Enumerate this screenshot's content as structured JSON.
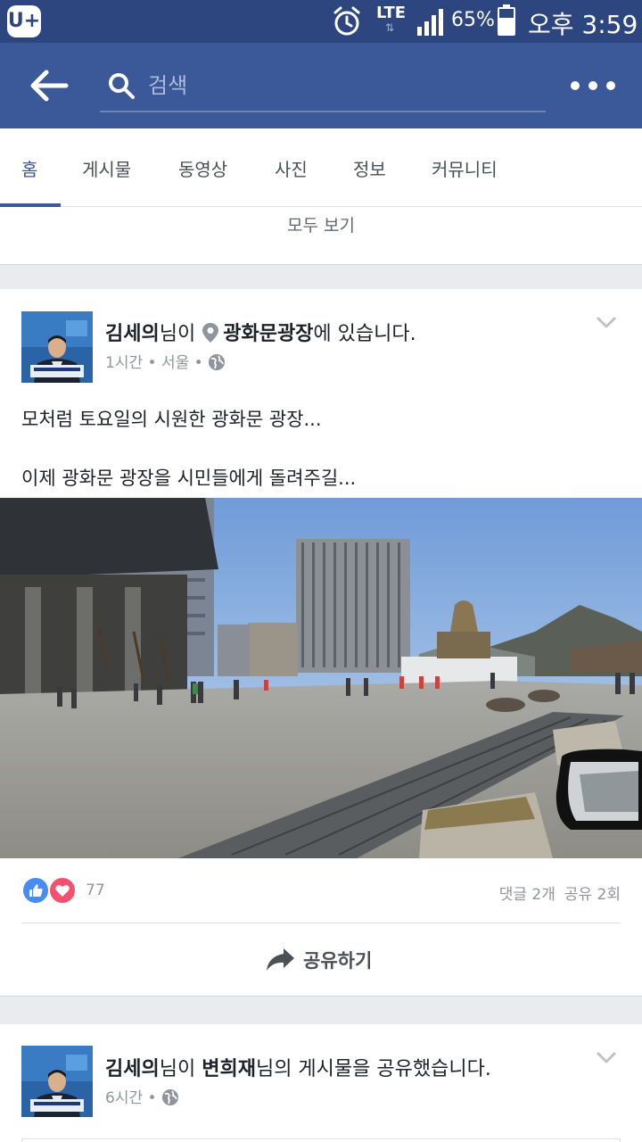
{
  "status_bar": {
    "carrier_logo": "U+",
    "network": "LTE",
    "battery_percent": "65%",
    "battery_level": 0.65,
    "time": "오후 3:59"
  },
  "nav": {
    "search_placeholder": "검색",
    "back_icon": "arrow-left-icon",
    "more_icon": "more-dots-icon"
  },
  "tabs": [
    {
      "label": "홈",
      "active": true
    },
    {
      "label": "게시물",
      "active": false
    },
    {
      "label": "동영상",
      "active": false
    },
    {
      "label": "사진",
      "active": false
    },
    {
      "label": "정보",
      "active": false
    },
    {
      "label": "커뮤니티",
      "active": false
    }
  ],
  "see_all": "모두 보기",
  "posts": [
    {
      "author": "김세의",
      "header_mid": "님이 ",
      "place": "광화문광장",
      "header_tail": "에 있습니다.",
      "time": "1시간",
      "location": "서울",
      "text_lines": [
        "모처럼 토요일의 시원한 광화문 광장...",
        "이제 광화문 광장을 시민들에게 돌려주길..."
      ],
      "reaction_count": "77",
      "comments": "댓글 2개",
      "shares": "공유 2회",
      "share_label": "공유하기"
    },
    {
      "author": "김세의",
      "header_mid": "님이 ",
      "shared_from": "변희재",
      "header_tail": "님의 게시물을 공유했습니다.",
      "time": "6시간"
    }
  ],
  "colors": {
    "status_bar": "#2d4680",
    "nav_bar": "#3b5998",
    "tab_active": "#3b5998",
    "like": "#4a8af4",
    "love": "#f2526e"
  }
}
